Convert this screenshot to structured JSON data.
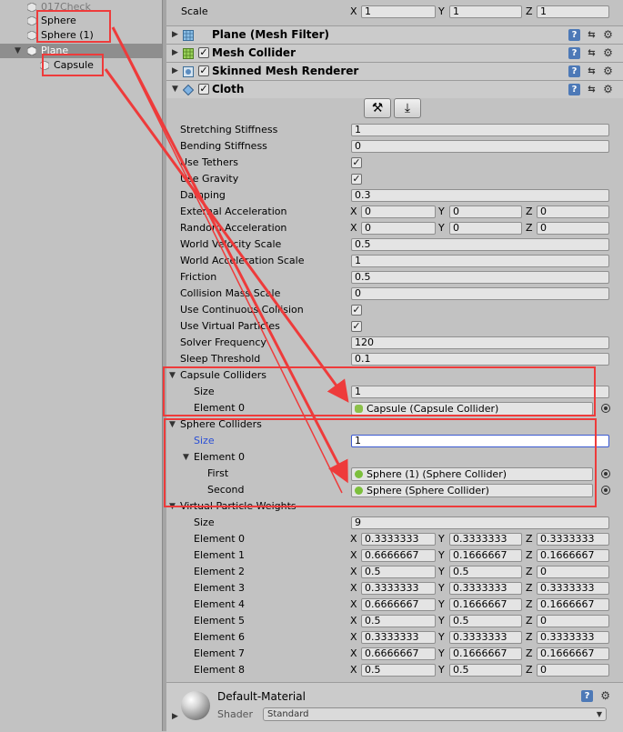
{
  "hierarchy": {
    "items": [
      {
        "label": "017Check"
      },
      {
        "label": "Sphere"
      },
      {
        "label": "Sphere (1)"
      },
      {
        "label": "Plane"
      },
      {
        "label": "Capsule"
      }
    ]
  },
  "inspector": {
    "scale": {
      "label": "Scale",
      "x": "1",
      "y": "1",
      "z": "1"
    },
    "components": {
      "mesh_filter": "Plane (Mesh Filter)",
      "mesh_collider": "Mesh Collider",
      "skinned_mesh_renderer": "Skinned Mesh Renderer",
      "cloth": "Cloth"
    },
    "cloth": {
      "stretching_stiffness": {
        "label": "Stretching Stiffness",
        "value": "1"
      },
      "bending_stiffness": {
        "label": "Bending Stiffness",
        "value": "0"
      },
      "use_tethers": {
        "label": "Use Tethers",
        "checked": true
      },
      "use_gravity": {
        "label": "Use Gravity",
        "checked": true
      },
      "damping": {
        "label": "Damping",
        "value": "0.3"
      },
      "external_acceleration": {
        "label": "External Acceleration",
        "x": "0",
        "y": "0",
        "z": "0"
      },
      "random_acceleration": {
        "label": "Random Acceleration",
        "x": "0",
        "y": "0",
        "z": "0"
      },
      "world_velocity_scale": {
        "label": "World Velocity Scale",
        "value": "0.5"
      },
      "world_acceleration_scale": {
        "label": "World Acceleration Scale",
        "value": "1"
      },
      "friction": {
        "label": "Friction",
        "value": "0.5"
      },
      "collision_mass_scale": {
        "label": "Collision Mass Scale",
        "value": "0"
      },
      "use_continuous_collision": {
        "label": "Use Continuous Collision",
        "checked": true
      },
      "use_virtual_particles": {
        "label": "Use Virtual Particles",
        "checked": true
      },
      "solver_frequency": {
        "label": "Solver Frequency",
        "value": "120"
      },
      "sleep_threshold": {
        "label": "Sleep Threshold",
        "value": "0.1"
      },
      "capsule_colliders": {
        "label": "Capsule Colliders",
        "size_label": "Size",
        "size": "1",
        "element0_label": "Element 0",
        "element0_value": "Capsule (Capsule Collider)"
      },
      "sphere_colliders": {
        "label": "Sphere Colliders",
        "size_label": "Size",
        "size": "1",
        "element0_label": "Element 0",
        "first_label": "First",
        "first_value": "Sphere (1) (Sphere Collider)",
        "second_label": "Second",
        "second_value": "Sphere (Sphere Collider)"
      },
      "virtual_particle_weights": {
        "label": "Virtual Particle Weights",
        "size_label": "Size",
        "size": "9",
        "elements": [
          {
            "label": "Element 0",
            "x": "0.3333333",
            "y": "0.3333333",
            "z": "0.3333333"
          },
          {
            "label": "Element 1",
            "x": "0.6666667",
            "y": "0.1666667",
            "z": "0.1666667"
          },
          {
            "label": "Element 2",
            "x": "0.5",
            "y": "0.5",
            "z": "0"
          },
          {
            "label": "Element 3",
            "x": "0.3333333",
            "y": "0.3333333",
            "z": "0.3333333"
          },
          {
            "label": "Element 4",
            "x": "0.6666667",
            "y": "0.1666667",
            "z": "0.1666667"
          },
          {
            "label": "Element 5",
            "x": "0.5",
            "y": "0.5",
            "z": "0"
          },
          {
            "label": "Element 6",
            "x": "0.3333333",
            "y": "0.3333333",
            "z": "0.3333333"
          },
          {
            "label": "Element 7",
            "x": "0.6666667",
            "y": "0.1666667",
            "z": "0.1666667"
          },
          {
            "label": "Element 8",
            "x": "0.5",
            "y": "0.5",
            "z": "0"
          }
        ]
      }
    },
    "material": {
      "name": "Default-Material",
      "shader_label": "Shader",
      "shader": "Standard"
    },
    "axis_labels": {
      "x": "X",
      "y": "Y",
      "z": "Z"
    }
  },
  "colors": {
    "annotation": "#ee3b3b",
    "focus": "#3a59d1",
    "size_label_focused": "#2a4fd6"
  }
}
